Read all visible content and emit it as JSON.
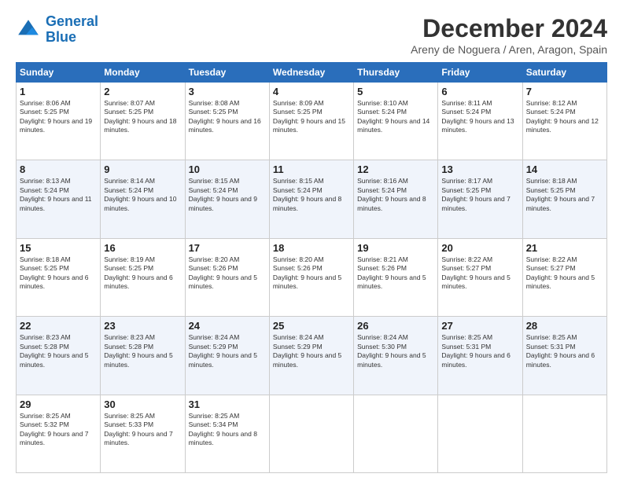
{
  "header": {
    "logo_line1": "General",
    "logo_line2": "Blue",
    "main_title": "December 2024",
    "subtitle": "Areny de Noguera / Aren, Aragon, Spain"
  },
  "weekdays": [
    "Sunday",
    "Monday",
    "Tuesday",
    "Wednesday",
    "Thursday",
    "Friday",
    "Saturday"
  ],
  "weeks": [
    [
      {
        "day": "1",
        "sunrise": "8:06 AM",
        "sunset": "5:25 PM",
        "daylight": "9 hours and 19 minutes."
      },
      {
        "day": "2",
        "sunrise": "8:07 AM",
        "sunset": "5:25 PM",
        "daylight": "9 hours and 18 minutes."
      },
      {
        "day": "3",
        "sunrise": "8:08 AM",
        "sunset": "5:25 PM",
        "daylight": "9 hours and 16 minutes."
      },
      {
        "day": "4",
        "sunrise": "8:09 AM",
        "sunset": "5:25 PM",
        "daylight": "9 hours and 15 minutes."
      },
      {
        "day": "5",
        "sunrise": "8:10 AM",
        "sunset": "5:24 PM",
        "daylight": "9 hours and 14 minutes."
      },
      {
        "day": "6",
        "sunrise": "8:11 AM",
        "sunset": "5:24 PM",
        "daylight": "9 hours and 13 minutes."
      },
      {
        "day": "7",
        "sunrise": "8:12 AM",
        "sunset": "5:24 PM",
        "daylight": "9 hours and 12 minutes."
      }
    ],
    [
      {
        "day": "8",
        "sunrise": "8:13 AM",
        "sunset": "5:24 PM",
        "daylight": "9 hours and 11 minutes."
      },
      {
        "day": "9",
        "sunrise": "8:14 AM",
        "sunset": "5:24 PM",
        "daylight": "9 hours and 10 minutes."
      },
      {
        "day": "10",
        "sunrise": "8:15 AM",
        "sunset": "5:24 PM",
        "daylight": "9 hours and 9 minutes."
      },
      {
        "day": "11",
        "sunrise": "8:15 AM",
        "sunset": "5:24 PM",
        "daylight": "9 hours and 8 minutes."
      },
      {
        "day": "12",
        "sunrise": "8:16 AM",
        "sunset": "5:24 PM",
        "daylight": "9 hours and 8 minutes."
      },
      {
        "day": "13",
        "sunrise": "8:17 AM",
        "sunset": "5:25 PM",
        "daylight": "9 hours and 7 minutes."
      },
      {
        "day": "14",
        "sunrise": "8:18 AM",
        "sunset": "5:25 PM",
        "daylight": "9 hours and 7 minutes."
      }
    ],
    [
      {
        "day": "15",
        "sunrise": "8:18 AM",
        "sunset": "5:25 PM",
        "daylight": "9 hours and 6 minutes."
      },
      {
        "day": "16",
        "sunrise": "8:19 AM",
        "sunset": "5:25 PM",
        "daylight": "9 hours and 6 minutes."
      },
      {
        "day": "17",
        "sunrise": "8:20 AM",
        "sunset": "5:26 PM",
        "daylight": "9 hours and 5 minutes."
      },
      {
        "day": "18",
        "sunrise": "8:20 AM",
        "sunset": "5:26 PM",
        "daylight": "9 hours and 5 minutes."
      },
      {
        "day": "19",
        "sunrise": "8:21 AM",
        "sunset": "5:26 PM",
        "daylight": "9 hours and 5 minutes."
      },
      {
        "day": "20",
        "sunrise": "8:22 AM",
        "sunset": "5:27 PM",
        "daylight": "9 hours and 5 minutes."
      },
      {
        "day": "21",
        "sunrise": "8:22 AM",
        "sunset": "5:27 PM",
        "daylight": "9 hours and 5 minutes."
      }
    ],
    [
      {
        "day": "22",
        "sunrise": "8:23 AM",
        "sunset": "5:28 PM",
        "daylight": "9 hours and 5 minutes."
      },
      {
        "day": "23",
        "sunrise": "8:23 AM",
        "sunset": "5:28 PM",
        "daylight": "9 hours and 5 minutes."
      },
      {
        "day": "24",
        "sunrise": "8:24 AM",
        "sunset": "5:29 PM",
        "daylight": "9 hours and 5 minutes."
      },
      {
        "day": "25",
        "sunrise": "8:24 AM",
        "sunset": "5:29 PM",
        "daylight": "9 hours and 5 minutes."
      },
      {
        "day": "26",
        "sunrise": "8:24 AM",
        "sunset": "5:30 PM",
        "daylight": "9 hours and 5 minutes."
      },
      {
        "day": "27",
        "sunrise": "8:25 AM",
        "sunset": "5:31 PM",
        "daylight": "9 hours and 6 minutes."
      },
      {
        "day": "28",
        "sunrise": "8:25 AM",
        "sunset": "5:31 PM",
        "daylight": "9 hours and 6 minutes."
      }
    ],
    [
      {
        "day": "29",
        "sunrise": "8:25 AM",
        "sunset": "5:32 PM",
        "daylight": "9 hours and 7 minutes."
      },
      {
        "day": "30",
        "sunrise": "8:25 AM",
        "sunset": "5:33 PM",
        "daylight": "9 hours and 7 minutes."
      },
      {
        "day": "31",
        "sunrise": "8:25 AM",
        "sunset": "5:34 PM",
        "daylight": "9 hours and 8 minutes."
      },
      null,
      null,
      null,
      null
    ]
  ]
}
